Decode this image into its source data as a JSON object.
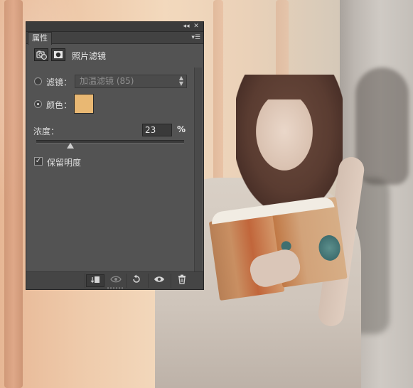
{
  "panel": {
    "tab_label": "属性",
    "collapse_icon": "double-chevron-left-icon",
    "close_icon": "close-icon",
    "menu_icon": "panel-menu-icon",
    "adjustment_title": "照片滤镜",
    "filter_label": "滤镜：",
    "filter_value": "加温滤镜 (85)",
    "color_label": "颜色：",
    "color_value": "#e9b873",
    "density_label": "浓度：",
    "density_value": "23",
    "density_unit": "%",
    "density_fraction": 0.23,
    "filter_selected": false,
    "color_selected": true,
    "preserve_luminosity_label": "保留明度",
    "preserve_luminosity_checked": true
  },
  "footer": {
    "buttons": [
      "clip-to-layer-icon",
      "view-previous-state-icon",
      "reset-icon",
      "visibility-eye-icon",
      "delete-trash-icon"
    ]
  }
}
